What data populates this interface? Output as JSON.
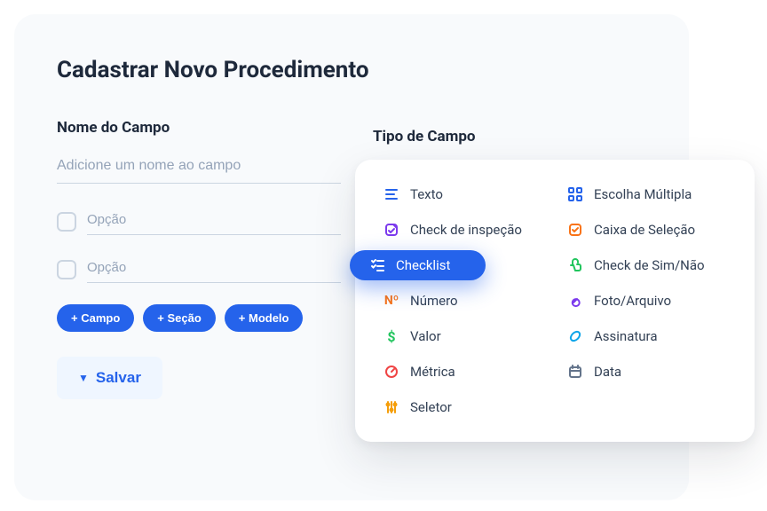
{
  "page_title": "Cadastrar Novo Procedimento",
  "left": {
    "field_name_label": "Nome do Campo",
    "field_name_placeholder": "Adicione um nome ao campo",
    "option_placeholder": "Opção",
    "pills": {
      "campo": "+ Campo",
      "secao": "+ Seção",
      "modelo": "+ Modelo"
    },
    "save_label": "Salvar"
  },
  "right": {
    "type_label": "Tipo de Campo",
    "types_left": [
      {
        "label": "Texto",
        "icon": "text",
        "color": "c-blue"
      },
      {
        "label": "Check de inspeção",
        "icon": "inspect",
        "color": "c-violet"
      },
      {
        "label": "Checklist",
        "icon": "checklist",
        "color": "c-blue",
        "selected": true
      },
      {
        "label": "Número",
        "icon": "number",
        "color": "c-orange"
      },
      {
        "label": "Valor",
        "icon": "value",
        "color": "c-green"
      },
      {
        "label": "Métrica",
        "icon": "metric",
        "color": "c-red"
      },
      {
        "label": "Seletor",
        "icon": "selector",
        "color": "c-amber"
      }
    ],
    "types_right": [
      {
        "label": "Escolha Múltipla",
        "icon": "multichoice",
        "color": "c-blue"
      },
      {
        "label": "Caixa de Seleção",
        "icon": "checkbox",
        "color": "c-orange"
      },
      {
        "label": "Check de Sim/Não",
        "icon": "yesno",
        "color": "c-green"
      },
      {
        "label": "Foto/Arquivo",
        "icon": "file",
        "color": "c-violet"
      },
      {
        "label": "Assinatura",
        "icon": "signature",
        "color": "c-cyan"
      },
      {
        "label": "Data",
        "icon": "date",
        "color": "c-gray"
      }
    ]
  }
}
